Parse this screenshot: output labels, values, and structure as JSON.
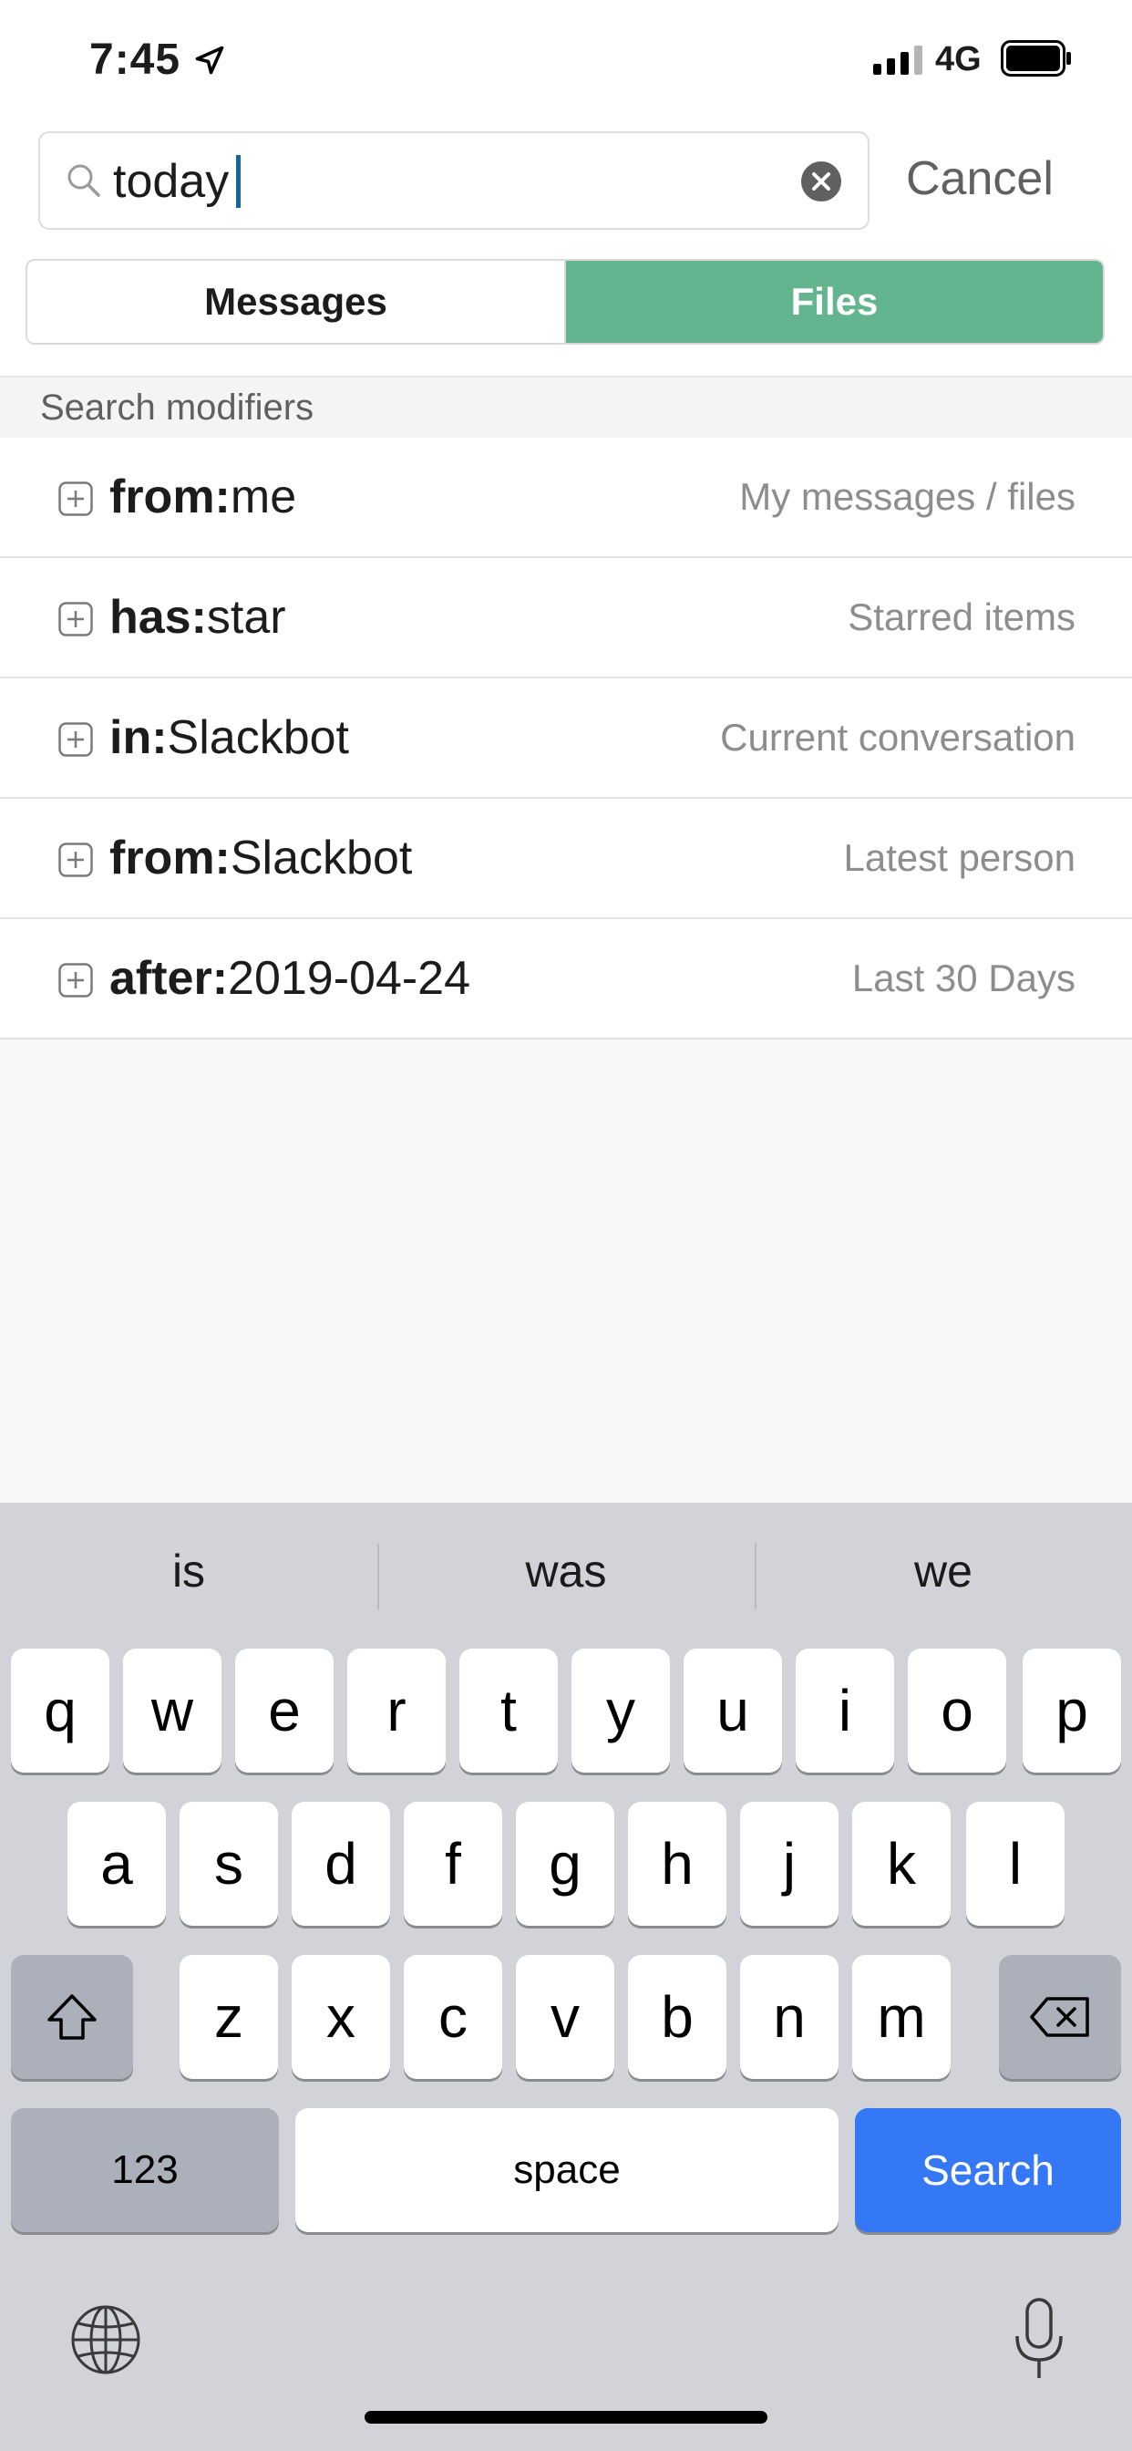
{
  "status_bar": {
    "time": "7:45",
    "network": "4G"
  },
  "search": {
    "query": "today",
    "cancel_label": "Cancel"
  },
  "tabs": [
    {
      "label": "Messages",
      "active": false
    },
    {
      "label": "Files",
      "active": true
    }
  ],
  "modifiers": {
    "section_label": "Search modifiers",
    "items": [
      {
        "key": "from:",
        "value": "me",
        "description": "My messages / files"
      },
      {
        "key": "has:",
        "value": "star",
        "description": "Starred items"
      },
      {
        "key": "in:",
        "value": "Slackbot",
        "description": "Current conversation"
      },
      {
        "key": "from:",
        "value": "Slackbot",
        "description": "Latest person"
      },
      {
        "key": "after:",
        "value": "2019-04-24",
        "description": "Last 30 Days"
      }
    ]
  },
  "keyboard": {
    "suggestions": [
      "is",
      "was",
      "we"
    ],
    "row1": [
      "q",
      "w",
      "e",
      "r",
      "t",
      "y",
      "u",
      "i",
      "o",
      "p"
    ],
    "row2": [
      "a",
      "s",
      "d",
      "f",
      "g",
      "h",
      "j",
      "k",
      "l"
    ],
    "row3": [
      "z",
      "x",
      "c",
      "v",
      "b",
      "n",
      "m"
    ],
    "numbers_label": "123",
    "space_label": "space",
    "search_label": "Search"
  },
  "colors": {
    "accent_green": "#63b58f",
    "search_blue": "#3478f6"
  }
}
